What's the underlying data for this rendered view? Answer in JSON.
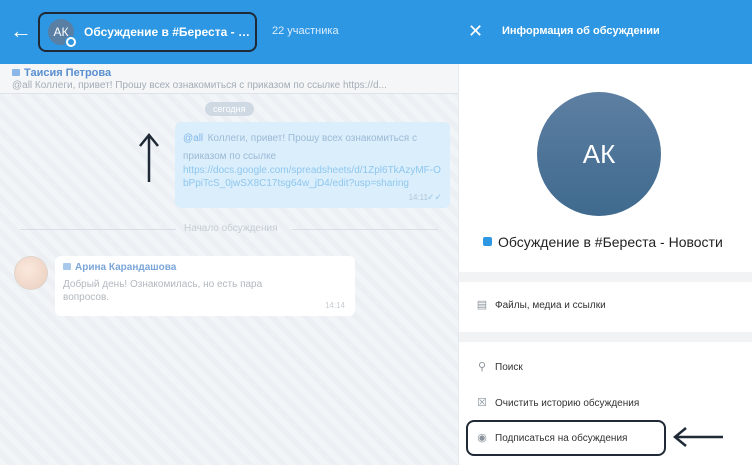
{
  "header": {
    "back_icon": "arrow-left-icon",
    "chat_avatar_initials": "АК",
    "chat_title": "Обсуждение в #Береста - Нов...",
    "participants": "22 участника",
    "close_icon": "close-icon",
    "info_title": "Информация об обсуждении"
  },
  "chat": {
    "pinned": {
      "author": "Таисия Петрова",
      "text": "@all Коллеги, привет! Прошу всех ознакомиться с приказом по ссылке https://d..."
    },
    "date_label": "сегодня",
    "own_message": {
      "mention": "@all",
      "text": "Коллеги, привет! Прошу всех ознакомиться с приказом по ссылке",
      "link": "https://docs.google.com/spreadsheets/d/1Zpl6TkAzyMF-ObPpiTcS_0jwSX8C17tsg64w_jD4/edit?usp=sharing",
      "time": "14:11"
    },
    "divider_label": "Начало обсуждения",
    "incoming_message": {
      "author": "Арина Карандашова",
      "text": "Добрый день! Ознакомилась, но есть пара вопросов.",
      "time": "14:14"
    }
  },
  "info": {
    "avatar_initials": "АК",
    "group_name": "Обсуждение в #Береста - Новости",
    "files_label": "Файлы, медиа и ссылки",
    "search_label": "Поиск",
    "clear_history_label": "Очистить историю обсуждения",
    "subscribe_label": "Подписаться на обсуждения"
  },
  "colors": {
    "header_blue": "#2d97e3",
    "annotation_dark": "#1f2a36"
  }
}
